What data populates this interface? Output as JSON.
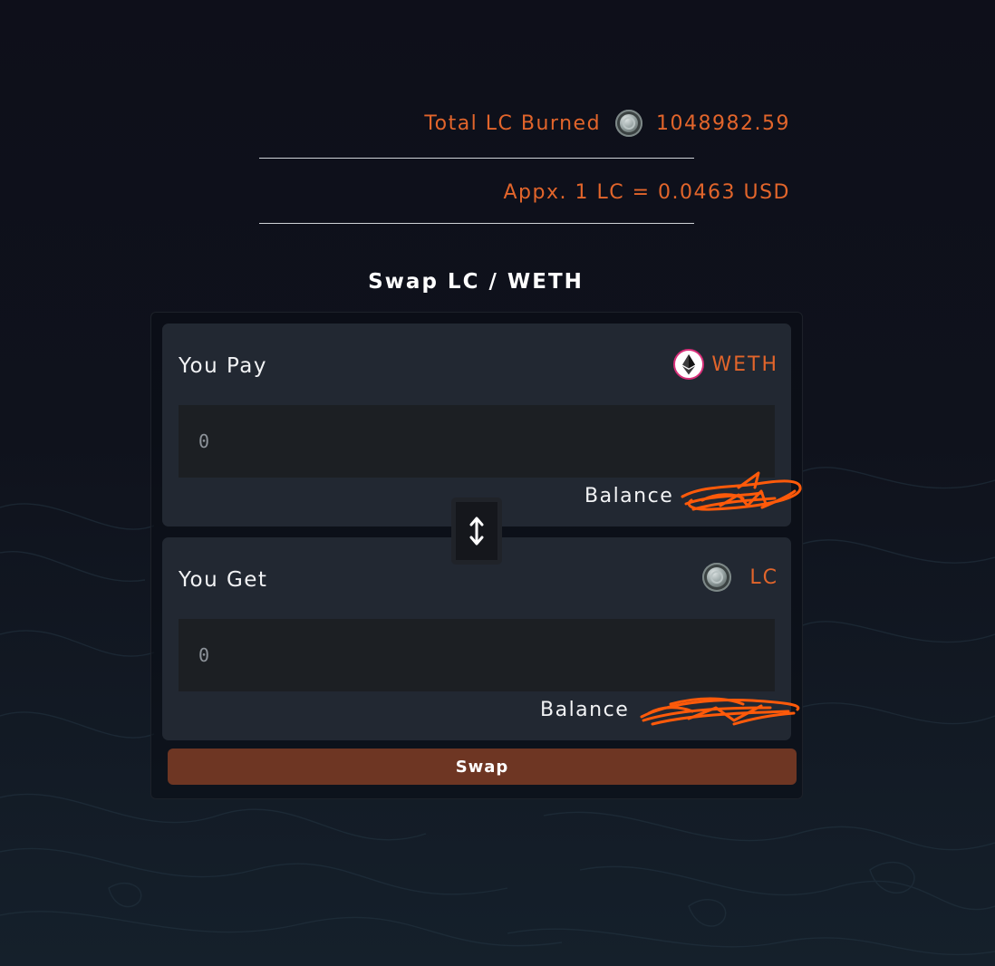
{
  "stats": {
    "burned_label": "Total LC Burned",
    "burned_icon": "lc-coin-icon",
    "burned_value": "1048982.59",
    "price_text": "Appx. 1 LC = 0.0463 USD"
  },
  "swap": {
    "title": "Swap LC / WETH",
    "pay": {
      "label": "You Pay",
      "token_icon": "eth-icon",
      "token": "WETH",
      "amount_placeholder": "0",
      "balance_label": "Balance"
    },
    "get": {
      "label": "You Get",
      "token_icon": "lc-coin-icon",
      "token": "LC",
      "amount_placeholder": "0",
      "balance_label": "Balance"
    },
    "switch_icon": "up-down-arrow-icon",
    "button_label": "Swap"
  },
  "colors": {
    "background": "#0e0f1a",
    "accent": "#e2652b",
    "panel": "#222832",
    "input": "#1c1f23",
    "swap_button": "#6e3623"
  }
}
